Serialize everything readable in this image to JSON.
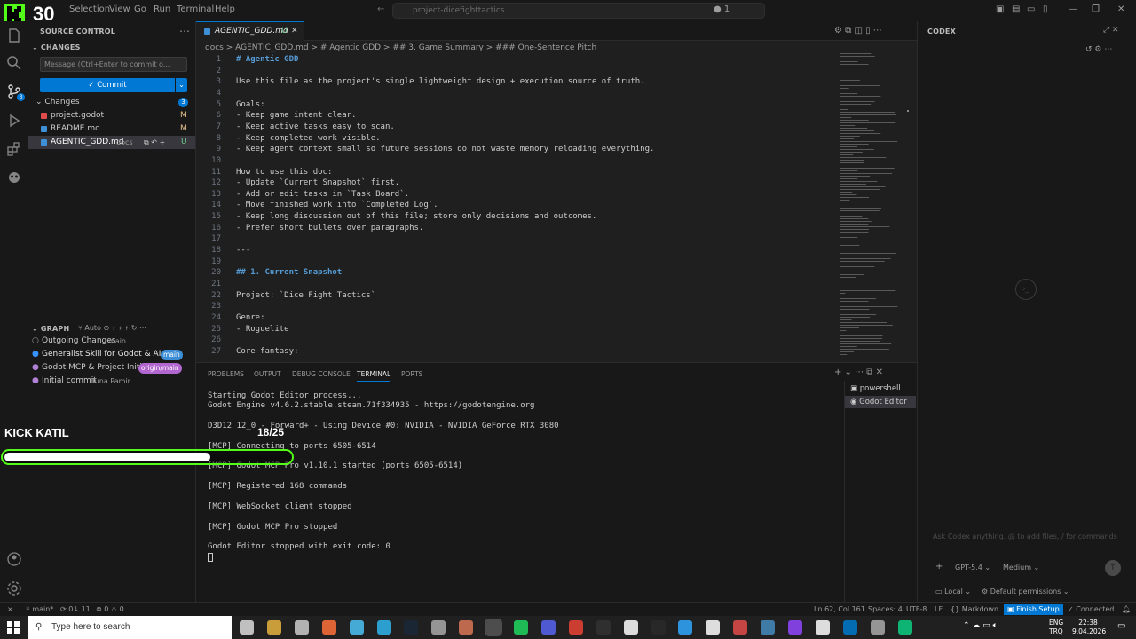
{
  "overlay": {
    "logo_text": "30",
    "kick_label": "KICK KATIL",
    "progress_text": "18/25",
    "progress_value": 0.72
  },
  "titlebar": {
    "menu": [
      "Selection",
      "View",
      "Go",
      "Run",
      "Terminal",
      "Help"
    ],
    "search": "project-dicefighttactics",
    "count": "1"
  },
  "sidebar": {
    "title": "SOURCE CONTROL",
    "changes_header": "CHANGES",
    "commit_placeholder": "Message (Ctrl+Enter to commit o...",
    "commit_label": "Commit",
    "changes_group": "Changes",
    "changes_count": "3",
    "files": [
      {
        "name": "project.godot",
        "status": "M"
      },
      {
        "name": "README.md",
        "status": "M"
      },
      {
        "name": "AGENTIC_GDD.md",
        "folder": "docs",
        "status": "U"
      }
    ],
    "graph_title": "GRAPH",
    "graph_auto": "Auto",
    "graph_items": [
      {
        "text": "Outgoing Changes",
        "meta": "main"
      },
      {
        "text": "Generalist Skill for Godot & AI ...",
        "badge": "main"
      },
      {
        "text": "Godot MCP & Project Initi...",
        "badge": "origin/main"
      },
      {
        "text": "Initial commit",
        "meta": "Tuna Pamir"
      }
    ]
  },
  "editor": {
    "tab_label": "AGENTIC_GDD.md",
    "tab_status": "U",
    "breadcrumb": "docs  >  AGENTIC_GDD.md  >  # Agentic GDD  >  ## 3. Game Summary  >  ### One-Sentence Pitch",
    "lines": [
      {
        "n": "1",
        "t": "# Agentic GDD",
        "k": "hd"
      },
      {
        "n": "2",
        "t": ""
      },
      {
        "n": "3",
        "t": "Use this file as the project's single lightweight design + execution source of truth."
      },
      {
        "n": "4",
        "t": ""
      },
      {
        "n": "5",
        "t": "Goals:"
      },
      {
        "n": "6",
        "t": "- Keep game intent clear."
      },
      {
        "n": "7",
        "t": "- Keep active tasks easy to scan."
      },
      {
        "n": "8",
        "t": "- Keep completed work visible."
      },
      {
        "n": "9",
        "t": "- Keep agent context small so future sessions do not waste memory reloading everything."
      },
      {
        "n": "10",
        "t": ""
      },
      {
        "n": "11",
        "t": "How to use this doc:"
      },
      {
        "n": "12",
        "t": "- Update `Current Snapshot` first."
      },
      {
        "n": "13",
        "t": "- Add or edit tasks in `Task Board`."
      },
      {
        "n": "14",
        "t": "- Move finished work into `Completed Log`."
      },
      {
        "n": "15",
        "t": "- Keep long discussion out of this file; store only decisions and outcomes."
      },
      {
        "n": "16",
        "t": "- Prefer short bullets over paragraphs."
      },
      {
        "n": "17",
        "t": ""
      },
      {
        "n": "18",
        "t": "---"
      },
      {
        "n": "19",
        "t": ""
      },
      {
        "n": "20",
        "t": "## 1. Current Snapshot",
        "k": "hd"
      },
      {
        "n": "21",
        "t": ""
      },
      {
        "n": "22",
        "t": "Project: `Dice Fight Tactics`"
      },
      {
        "n": "23",
        "t": ""
      },
      {
        "n": "24",
        "t": "Genre:"
      },
      {
        "n": "25",
        "t": "- Roguelite"
      },
      {
        "n": "26",
        "t": ""
      },
      {
        "n": "27",
        "t": "Core fantasy:"
      }
    ]
  },
  "panel": {
    "tabs": [
      "PROBLEMS",
      "OUTPUT",
      "DEBUG CONSOLE",
      "TERMINAL",
      "PORTS"
    ],
    "active_tab": "TERMINAL",
    "terminal_lines": [
      "Starting Godot Editor process...",
      "Godot Engine v4.6.2.stable.steam.71f334935 - https://godotengine.org",
      "",
      "D3D12 12_0 - Forward+ - Using Device #0: NVIDIA - NVIDIA GeForce RTX 3080",
      "",
      "[MCP] Connecting to ports 6505-6514",
      "",
      "[MCP] Godot MCP Pro v1.10.1 started (ports 6505-6514)",
      "",
      "[MCP] Registered 168 commands",
      "",
      "[MCP] WebSocket client stopped",
      "",
      "[MCP] Godot MCP Pro stopped",
      "",
      "Godot Editor stopped with exit code: 0"
    ],
    "terminals": [
      "powershell",
      "Godot Editor"
    ]
  },
  "codex": {
    "title": "CODEX",
    "input_placeholder": "Ask Codex anything. @ to add files, / for commands",
    "model": "GPT-5.4",
    "effort": "Medium",
    "env": "Local",
    "permissions": "Default permissions"
  },
  "statusbar": {
    "branch": "main*",
    "sync": "0↓ 11",
    "problems": "⊗ 0 ⚠ 0",
    "position": "Ln 62, Col 161",
    "spaces": "Spaces: 4",
    "encoding": "UTF-8",
    "eol": "LF",
    "language": "Markdown",
    "finish_setup": "Finish Setup",
    "connected": "Connected"
  },
  "taskbar": {
    "search_placeholder": "Type here to search",
    "lang": "ENG",
    "lang2": "TRQ",
    "time": "22:38",
    "date": "9.04.2026"
  }
}
